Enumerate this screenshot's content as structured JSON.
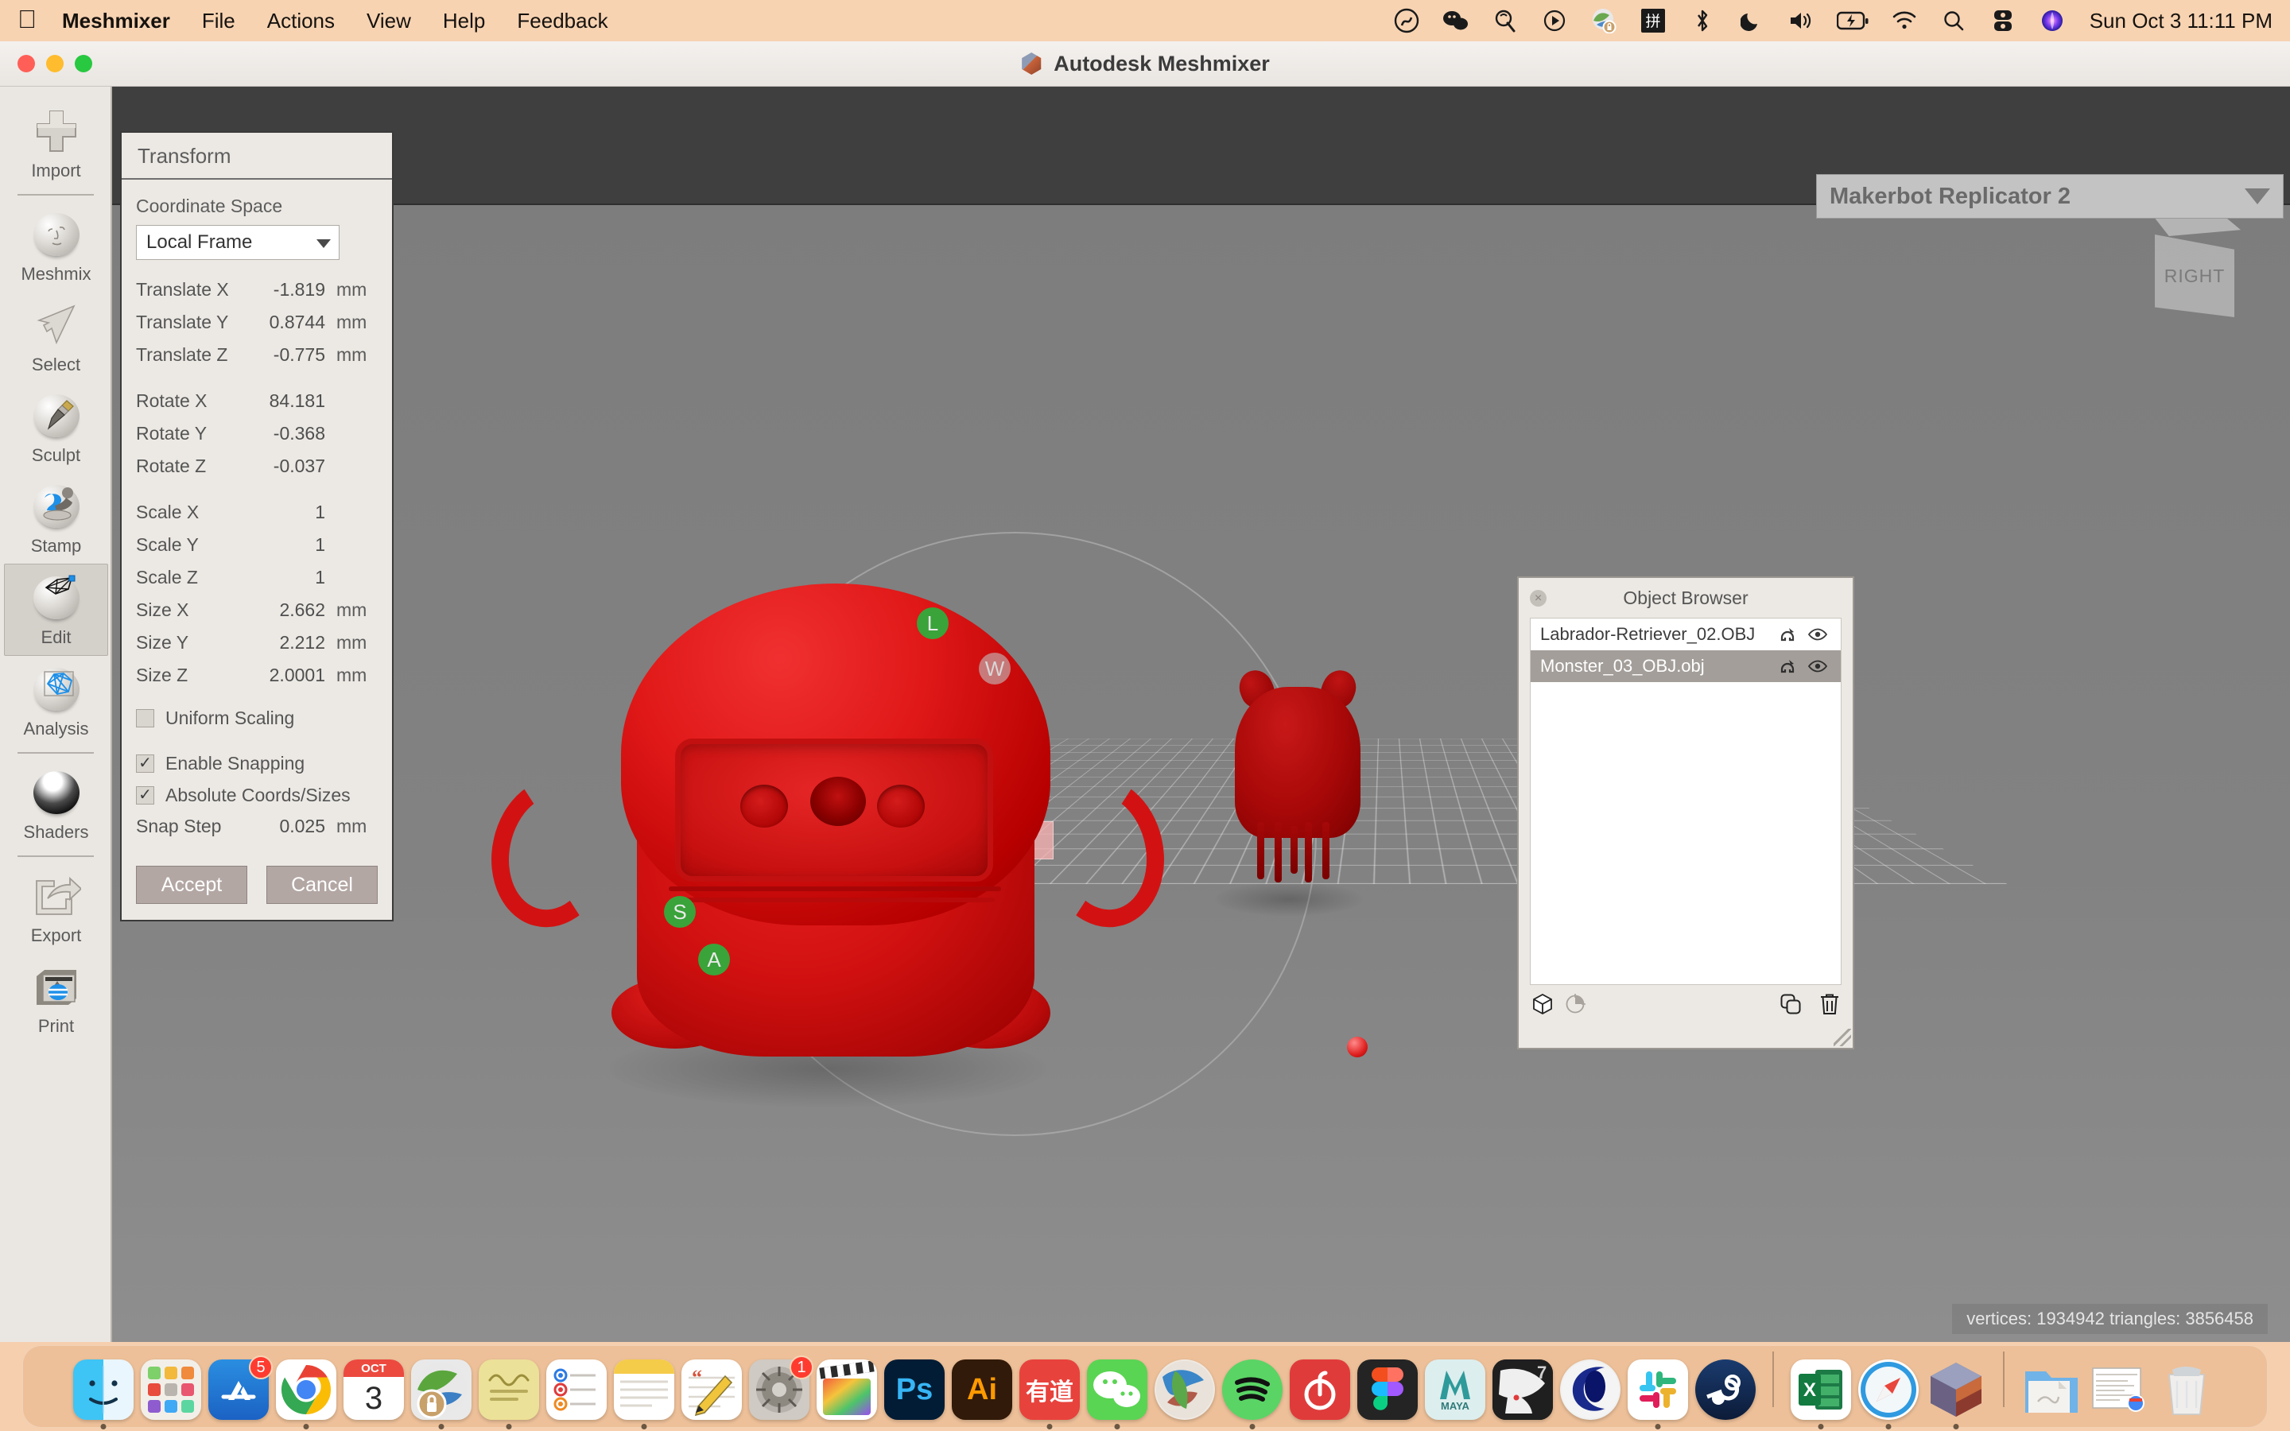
{
  "menubar": {
    "apple_icon": "apple-logo-icon",
    "items": [
      "Meshmixer",
      "File",
      "Actions",
      "View",
      "Help",
      "Feedback"
    ],
    "status_icons": [
      "creative-cloud-icon",
      "wechat-icon",
      "alfred-icon",
      "play-circle-icon",
      "onedrive-lock-icon",
      "pinyin-input-icon",
      "bluetooth-icon",
      "do-not-disturb-moon-icon",
      "volume-icon",
      "battery-charging-icon",
      "wifi-icon",
      "spotlight-search-icon",
      "control-center-icon",
      "siri-icon"
    ],
    "clock": "Sun Oct 3  11:11 PM"
  },
  "window": {
    "title": "Autodesk Meshmixer",
    "logo": "meshmixer-polyhedron-icon",
    "traffic_lights": [
      "close",
      "minimize",
      "zoom"
    ]
  },
  "toolbar": {
    "items": [
      {
        "label": "Import",
        "icon": "plus-icon",
        "selected": false
      },
      {
        "label": "Meshmix",
        "icon": "face-sphere-icon",
        "selected": false
      },
      {
        "label": "Select",
        "icon": "arrow-cursor-icon",
        "selected": false
      },
      {
        "label": "Sculpt",
        "icon": "brush-sphere-icon",
        "selected": false
      },
      {
        "label": "Stamp",
        "icon": "stamp-sphere-icon",
        "selected": false
      },
      {
        "label": "Edit",
        "icon": "wireframe-sphere-icon",
        "selected": true
      },
      {
        "label": "Analysis",
        "icon": "triangles-sphere-icon",
        "selected": false
      },
      {
        "label": "Shaders",
        "icon": "glossy-sphere-icon",
        "selected": false
      },
      {
        "label": "Export",
        "icon": "export-arrow-icon",
        "selected": false
      },
      {
        "label": "Print",
        "icon": "printer-icon",
        "selected": false
      }
    ]
  },
  "transform_panel": {
    "title": "Transform",
    "coordinate_space_label": "Coordinate Space",
    "coordinate_space_value": "Local Frame",
    "rows": [
      {
        "label": "Translate X",
        "value": "-1.819",
        "unit": "mm"
      },
      {
        "label": "Translate Y",
        "value": "0.8744",
        "unit": "mm"
      },
      {
        "label": "Translate Z",
        "value": "-0.775",
        "unit": "mm"
      }
    ],
    "rotate_rows": [
      {
        "label": "Rotate X",
        "value": "84.181",
        "unit": ""
      },
      {
        "label": "Rotate Y",
        "value": "-0.368",
        "unit": ""
      },
      {
        "label": "Rotate Z",
        "value": "-0.037",
        "unit": ""
      }
    ],
    "scale_rows": [
      {
        "label": "Scale X",
        "value": "1",
        "unit": ""
      },
      {
        "label": "Scale Y",
        "value": "1",
        "unit": ""
      },
      {
        "label": "Scale Z",
        "value": "1",
        "unit": ""
      },
      {
        "label": "Size X",
        "value": "2.662",
        "unit": "mm"
      },
      {
        "label": "Size Y",
        "value": "2.212",
        "unit": "mm"
      },
      {
        "label": "Size Z",
        "value": "2.0001",
        "unit": "mm"
      }
    ],
    "checkboxes": [
      {
        "label": "Uniform Scaling",
        "checked": false
      },
      {
        "label": "Enable Snapping",
        "checked": true
      },
      {
        "label": "Absolute Coords/Sizes",
        "checked": true
      }
    ],
    "snap_step": {
      "label": "Snap Step",
      "value": "0.025",
      "unit": "mm"
    },
    "accept_label": "Accept",
    "cancel_label": "Cancel"
  },
  "object_browser": {
    "title": "Object Browser",
    "close_icon": "close-icon",
    "rows": [
      {
        "name": "Labrador-Retriever_02.OBJ",
        "selected": false,
        "pin_icon": "magnet-icon",
        "eye_icon": "eye-icon"
      },
      {
        "name": "Monster_03_OBJ.obj",
        "selected": true,
        "pin_icon": "magnet-icon",
        "eye_icon": "eye-icon"
      }
    ],
    "footer_icons": [
      "cube-icon",
      "pie-icon",
      "duplicate-icon",
      "trash-icon"
    ],
    "resize_handle": "resize-grip-icon"
  },
  "viewport": {
    "printer_selector": {
      "value": "Makerbot Replicator 2",
      "arrow": "chevron-down-icon"
    },
    "view_cube_label": "RIGHT",
    "gizmo_handles": [
      {
        "letter": "L",
        "kind": "green"
      },
      {
        "letter": "W",
        "kind": "grey"
      },
      {
        "letter": "S",
        "kind": "green"
      },
      {
        "letter": "A",
        "kind": "green"
      }
    ],
    "status_text": "vertices: 1934942 triangles: 3856458"
  },
  "dock": {
    "items": [
      {
        "name": "finder",
        "label": "",
        "running": true
      },
      {
        "name": "launchpad",
        "label": "",
        "running": false
      },
      {
        "name": "app-store",
        "label": "",
        "badge": "5",
        "running": false
      },
      {
        "name": "google-chrome",
        "label": "",
        "running": true
      },
      {
        "name": "calendar",
        "label": "3",
        "sublabel": "OCT",
        "running": false
      },
      {
        "name": "onedrive",
        "label": "",
        "running": true
      },
      {
        "name": "stickies",
        "label": "",
        "running": true
      },
      {
        "name": "reminders",
        "label": "",
        "running": false
      },
      {
        "name": "notes",
        "label": "",
        "running": true
      },
      {
        "name": "textedit",
        "label": "",
        "running": false
      },
      {
        "name": "system-settings",
        "label": "",
        "badge": "1",
        "running": false
      },
      {
        "name": "final-cut-pro",
        "label": "",
        "running": false
      },
      {
        "name": "photoshop",
        "label": "Ps",
        "running": false
      },
      {
        "name": "illustrator",
        "label": "Ai",
        "running": false
      },
      {
        "name": "youdao-dict",
        "label": "有道",
        "running": true
      },
      {
        "name": "wechat",
        "label": "",
        "running": true
      },
      {
        "name": "zbrush",
        "label": "",
        "running": false
      },
      {
        "name": "spotify",
        "label": "",
        "running": true
      },
      {
        "name": "netease-music",
        "label": "",
        "running": false
      },
      {
        "name": "figma",
        "label": "",
        "running": false
      },
      {
        "name": "maya",
        "label": "MAYA",
        "running": false
      },
      {
        "name": "substance-painter",
        "label": "7",
        "running": false
      },
      {
        "name": "cinema4d",
        "label": "",
        "running": false
      },
      {
        "name": "slack",
        "label": "",
        "running": true
      },
      {
        "name": "steam",
        "label": "",
        "running": false
      },
      {
        "name": "excel",
        "label": "X",
        "running": true
      },
      {
        "name": "safari",
        "label": "",
        "running": true
      },
      {
        "name": "meshmixer",
        "label": "",
        "running": true
      },
      {
        "name": "downloads-folder",
        "label": "",
        "running": false
      },
      {
        "name": "document-stack",
        "label": "",
        "running": false
      },
      {
        "name": "trash",
        "label": "",
        "running": false
      }
    ]
  }
}
